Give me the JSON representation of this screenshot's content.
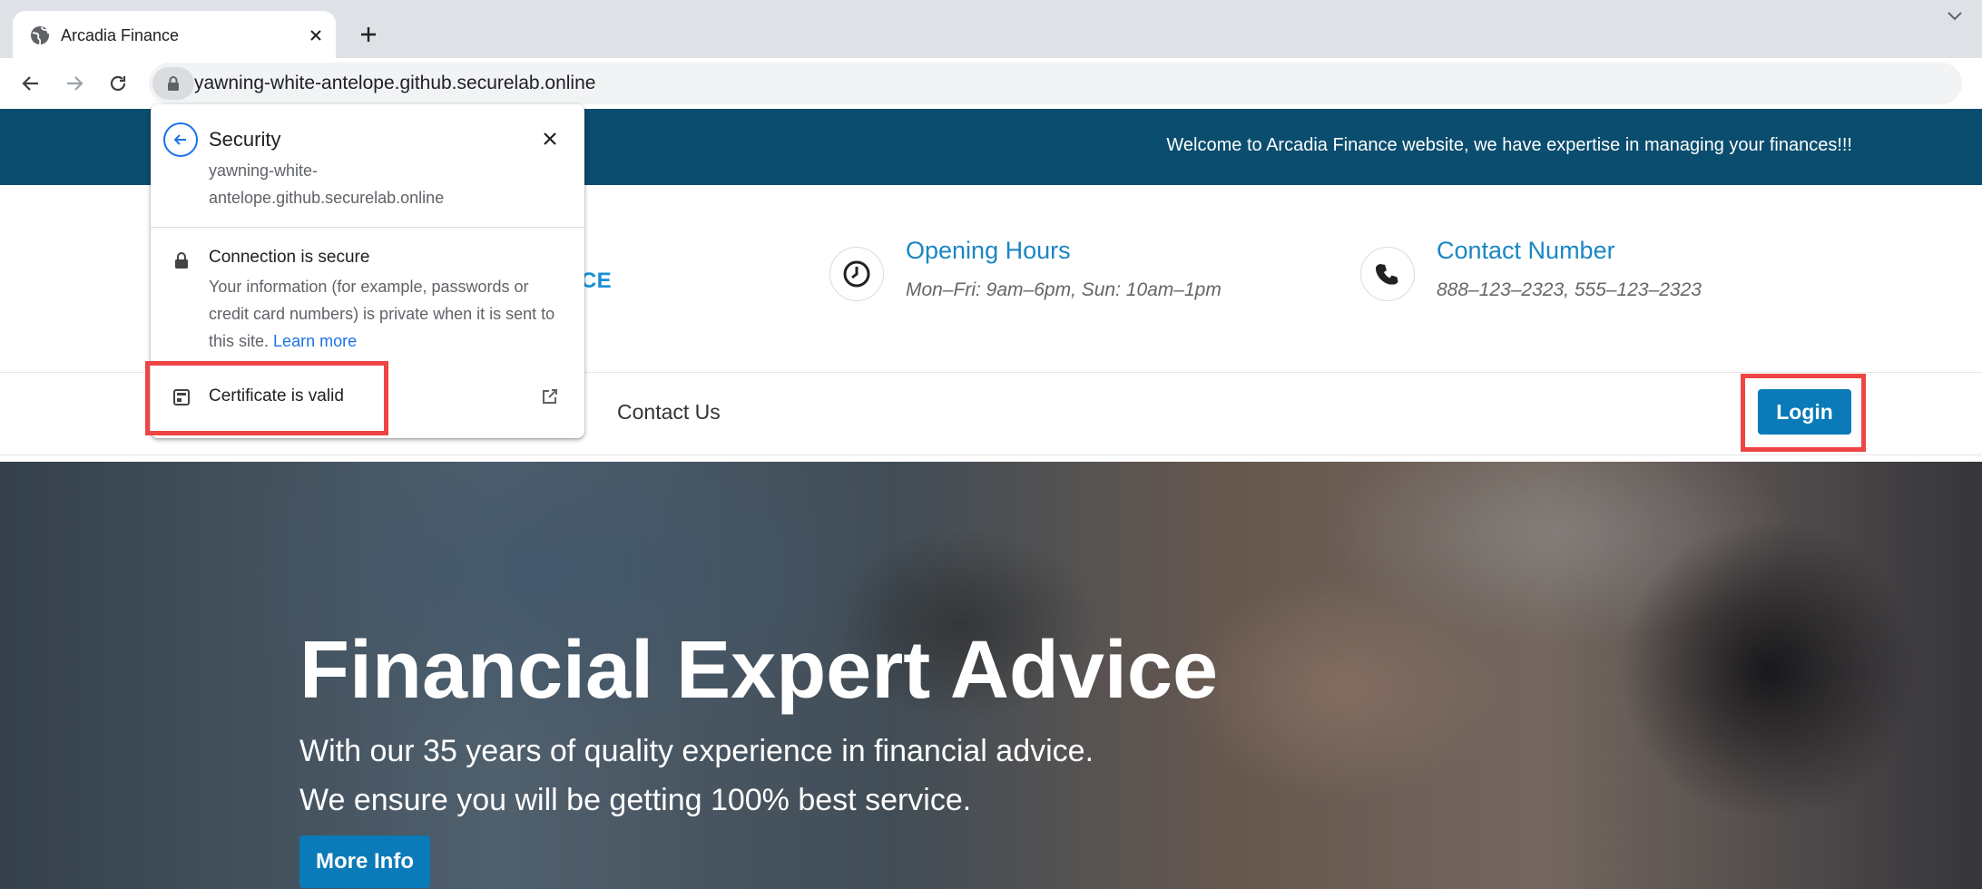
{
  "browser": {
    "tab_title": "Arcadia Finance",
    "url": "yawning-white-antelope.github.securelab.online"
  },
  "site": {
    "welcome_text": "Welcome to Arcadia Finance website, we have expertise in managing your finances!!!",
    "brand_fragment": "NCE",
    "opening_hours": {
      "title": "Opening Hours",
      "text": "Mon–Fri: 9am–6pm, Sun: 10am–1pm",
      "icon": "clock-icon"
    },
    "contact": {
      "title": "Contact Number",
      "text": "888–123–2323, 555–123–2323",
      "icon": "phone-icon"
    },
    "nav": {
      "contact_us": "Contact Us",
      "login": "Login"
    },
    "hero": {
      "title": "Financial Expert Advice",
      "line1": "With our 35 years of quality experience in financial advice.",
      "line2": "We ensure you will be getting 100% best service.",
      "button": "More Info"
    }
  },
  "security_popup": {
    "title": "Security",
    "host": "yawning-white-antelope.github.securelab.online",
    "connection_title": "Connection is secure",
    "connection_text": "Your information (for example, passwords or credit card numbers) is private when it is sent to this site.",
    "learn_more": "Learn more",
    "certificate": "Certificate is valid"
  },
  "colors": {
    "topbar": "#0a4d6e",
    "accent": "#0a7ab8",
    "highlight": "#ef4444",
    "chrome_link": "#1a73e8"
  }
}
